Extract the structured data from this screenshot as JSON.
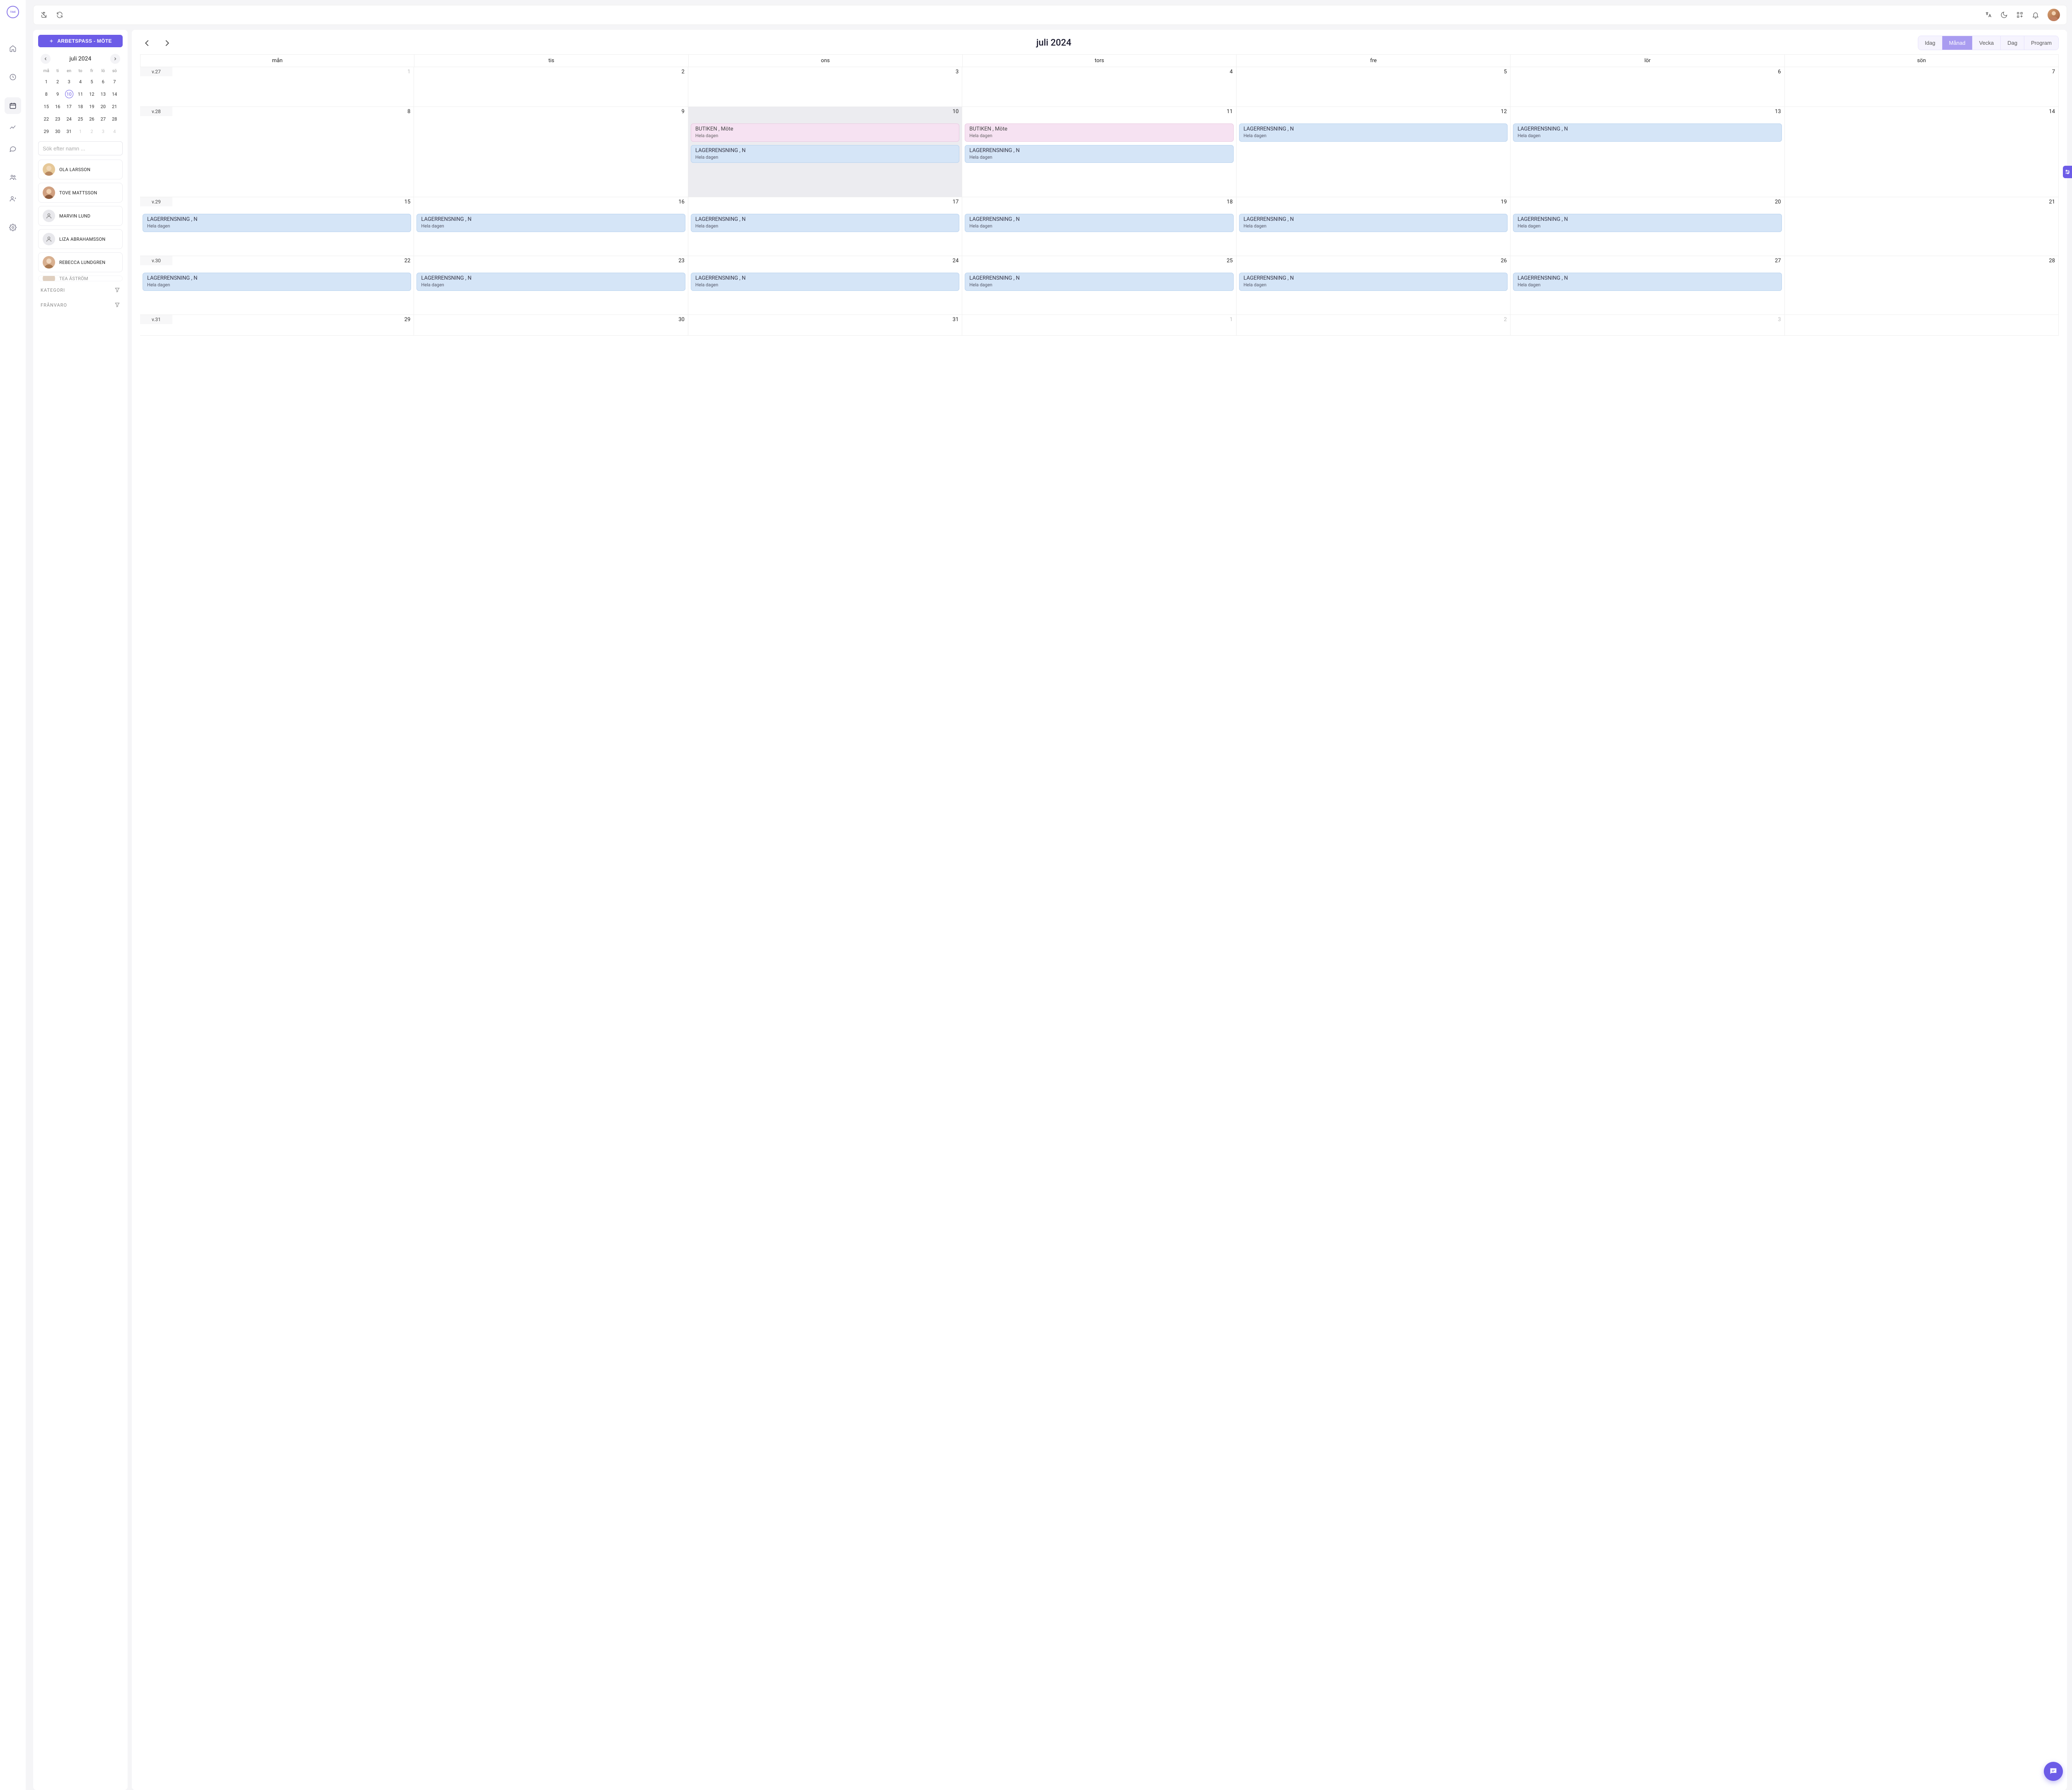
{
  "header": {
    "title": "juli 2024",
    "views": {
      "today": "Idag",
      "month": "Månad",
      "week": "Vecka",
      "day": "Dag",
      "program": "Program"
    }
  },
  "sidebar": {
    "new_button": "ARBETSPASS - MÖTE",
    "month_title": "juli 2024",
    "dow": [
      "må",
      "ti",
      "en",
      "to",
      "fr",
      "lö",
      "sö"
    ],
    "weeks": [
      [
        "1",
        "2",
        "3",
        "4",
        "5",
        "6",
        "7"
      ],
      [
        "8",
        "9",
        "10",
        "11",
        "12",
        "13",
        "14"
      ],
      [
        "15",
        "16",
        "17",
        "18",
        "19",
        "20",
        "21"
      ],
      [
        "22",
        "23",
        "24",
        "25",
        "26",
        "27",
        "28"
      ],
      [
        "29",
        "30",
        "31",
        "1",
        "2",
        "3",
        "4"
      ]
    ],
    "selected_day": "10",
    "search_placeholder": "Sök efter namn ...",
    "people": [
      "OLA LARSSON",
      "TOVE MATTSSON",
      "MARVIN LUND",
      "LIZA ABRAHAMSSON",
      "REBECCA LUNDGREN",
      "TEA ÅSTRÖM"
    ],
    "filters": {
      "category": "KATEGORI",
      "absence": "FRÅNVARO"
    }
  },
  "calendar": {
    "dow": [
      "mån",
      "tis",
      "ons",
      "tors",
      "fre",
      "lör",
      "sön"
    ],
    "weeks": [
      {
        "label": "v.27",
        "days": [
          "1",
          "2",
          "3",
          "4",
          "5",
          "6",
          "7"
        ]
      },
      {
        "label": "v.28",
        "days": [
          "8",
          "9",
          "10",
          "11",
          "12",
          "13",
          "14"
        ]
      },
      {
        "label": "v.29",
        "days": [
          "15",
          "16",
          "17",
          "18",
          "19",
          "20",
          "21"
        ]
      },
      {
        "label": "v.30",
        "days": [
          "22",
          "23",
          "24",
          "25",
          "26",
          "27",
          "28"
        ]
      },
      {
        "label": "v.31",
        "days": [
          "29",
          "30",
          "31",
          "1",
          "2",
          "3"
        ]
      }
    ],
    "events": {
      "butiken": {
        "title": "BUTIKEN , Möte",
        "sub": "Hela dagen"
      },
      "lager": {
        "title": "LAGERRENSNING , N",
        "sub": "Hela dagen"
      }
    }
  }
}
